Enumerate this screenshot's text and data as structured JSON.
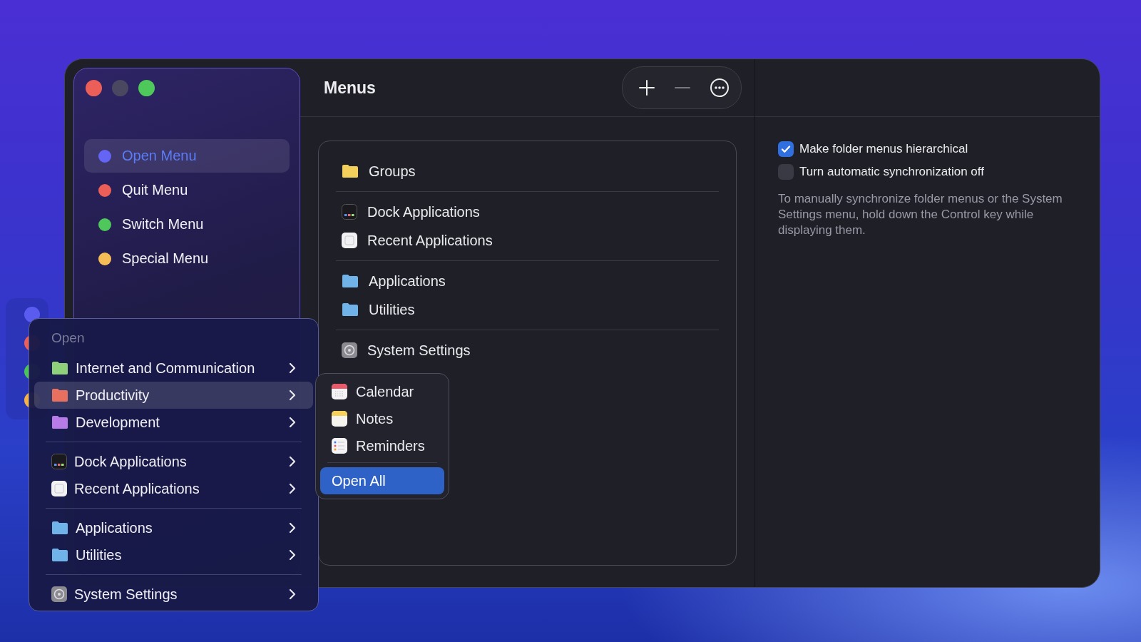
{
  "background_window": {
    "dots": [
      {
        "color": "#5a5cf0"
      },
      {
        "color": "#e8605a"
      },
      {
        "color": "#4cc35a"
      },
      {
        "color": "#f4b24a"
      }
    ]
  },
  "window": {
    "title": "Menus"
  },
  "sidebar": {
    "items": [
      {
        "label": "Open Menu",
        "color": "#6464f5",
        "selected": true
      },
      {
        "label": "Quit Menu",
        "color": "#ec5f59",
        "selected": false
      },
      {
        "label": "Switch Menu",
        "color": "#4ec85a",
        "selected": false
      },
      {
        "label": "Special Menu",
        "color": "#f6bd56",
        "selected": false
      }
    ]
  },
  "menu_list": {
    "groups": [
      [
        {
          "label": "Groups",
          "kind": "folder",
          "color": "#f2cf5b"
        }
      ],
      [
        {
          "label": "Dock Applications",
          "kind": "dock"
        },
        {
          "label": "Recent Applications",
          "kind": "window"
        }
      ],
      [
        {
          "label": "Applications",
          "kind": "folder",
          "color": "#6fb3e8"
        },
        {
          "label": "Utilities",
          "kind": "folder",
          "color": "#6fb3e8"
        }
      ],
      [
        {
          "label": "System Settings",
          "kind": "gear"
        }
      ]
    ]
  },
  "options": {
    "checkboxes": [
      {
        "label": "Make folder menus hierarchical",
        "checked": true
      },
      {
        "label": "Turn automatic synchronization off",
        "checked": false
      }
    ],
    "note": "To manually synchronize folder menus or the System Settings menu, hold down the Control key while displaying them."
  },
  "context_menu": {
    "header": "Open",
    "groups": [
      [
        {
          "label": "Internet and Communication",
          "kind": "folder",
          "color": "#8fcf7a",
          "selected": false
        },
        {
          "label": "Productivity",
          "kind": "folder",
          "color": "#e8705e",
          "selected": true
        },
        {
          "label": "Development",
          "kind": "folder",
          "color": "#b77ae6",
          "selected": false
        }
      ],
      [
        {
          "label": "Dock Applications",
          "kind": "dock",
          "selected": false
        },
        {
          "label": "Recent Applications",
          "kind": "window",
          "selected": false
        }
      ],
      [
        {
          "label": "Applications",
          "kind": "folder",
          "color": "#6fb3e8",
          "selected": false
        },
        {
          "label": "Utilities",
          "kind": "folder",
          "color": "#6fb3e8",
          "selected": false
        }
      ],
      [
        {
          "label": "System Settings",
          "kind": "gear",
          "selected": false
        }
      ]
    ]
  },
  "submenu": {
    "items": [
      {
        "label": "Calendar",
        "kind": "calendar",
        "selected": false
      },
      {
        "label": "Notes",
        "kind": "notes",
        "selected": false
      },
      {
        "label": "Reminders",
        "kind": "reminders",
        "selected": false
      }
    ],
    "action": {
      "label": "Open All",
      "selected": true
    }
  }
}
